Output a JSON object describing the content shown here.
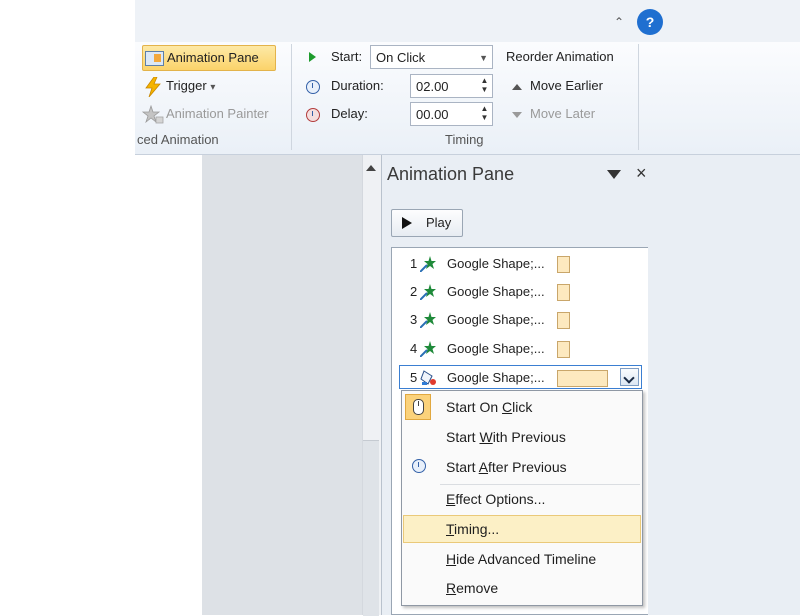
{
  "help": {
    "caret": "⌃",
    "label": "?"
  },
  "advanced_animation": {
    "animation_pane_label": "Animation Pane",
    "trigger_label": "Trigger",
    "trigger_caret": "▾",
    "animation_painter_label": "Animation Painter",
    "group_label": "ced Animation"
  },
  "timing": {
    "start_label": "Start:",
    "start_value": "On Click",
    "duration_label": "Duration:",
    "duration_value": "02.00",
    "delay_label": "Delay:",
    "delay_value": "00.00",
    "group_label": "Timing",
    "reorder_title": "Reorder Animation",
    "move_earlier_label": "Move Earlier",
    "move_later_label": "Move Later",
    "spin_glyph": "▲▼",
    "dropdown_glyph": "▼"
  },
  "pane": {
    "title": "Animation Pane",
    "close_glyph": "×",
    "play_label": "Play",
    "items": [
      {
        "num": "1",
        "label": "Google Shape;..."
      },
      {
        "num": "2",
        "label": "Google Shape;..."
      },
      {
        "num": "3",
        "label": "Google Shape;..."
      },
      {
        "num": "4",
        "label": "Google Shape;..."
      },
      {
        "num": "5",
        "label": "Google Shape;..."
      }
    ]
  },
  "context_menu": {
    "start_on_click": {
      "pre": "Start On ",
      "key": "C",
      "post": "lick"
    },
    "start_with_previous": {
      "pre": "Start ",
      "key": "W",
      "post": "ith Previous"
    },
    "start_after_previous": {
      "pre": "Start ",
      "key": "A",
      "post": "fter Previous"
    },
    "effect_options": {
      "pre": "",
      "key": "E",
      "post": "ffect Options..."
    },
    "timing": {
      "pre": "",
      "key": "T",
      "post": "iming..."
    },
    "hide_advanced_timeline": {
      "pre": "",
      "key": "H",
      "post": "ide Advanced Timeline"
    },
    "remove": {
      "pre": "",
      "key": "R",
      "post": "emove"
    }
  },
  "colors": {
    "highlight": "#fcf0c6",
    "accent_blue": "#3b7fd2",
    "timing_bar": "#fde9bf"
  }
}
